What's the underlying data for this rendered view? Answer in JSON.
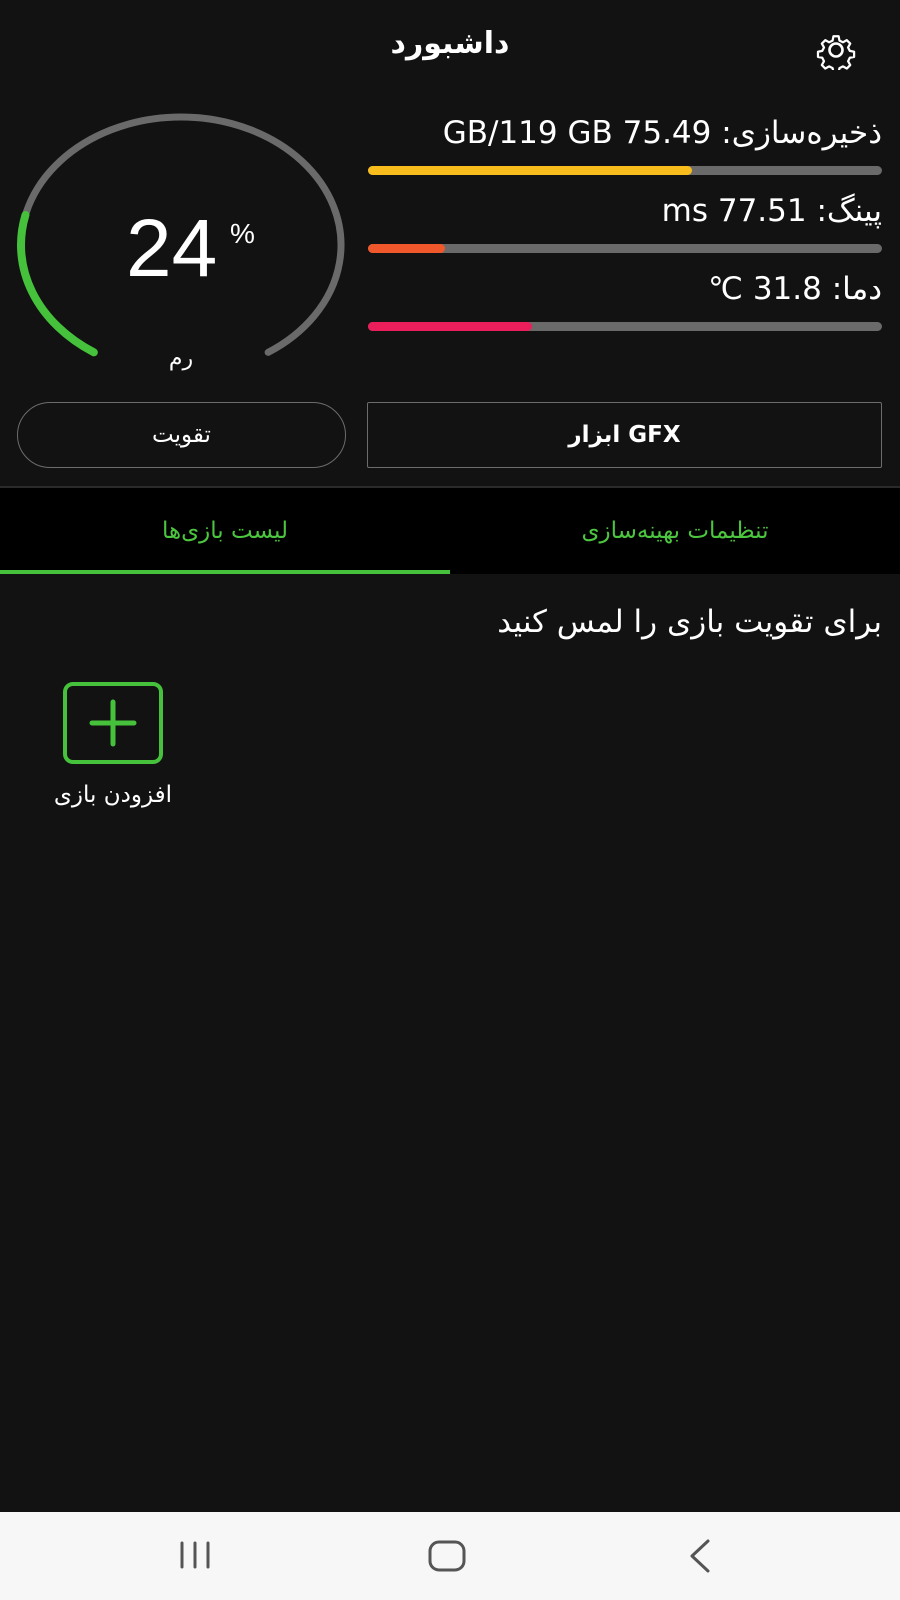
{
  "header": {
    "title": "داشبورد",
    "settings_icon": "gear-icon"
  },
  "gauge": {
    "value": "24",
    "unit": "%",
    "label": "رم",
    "percent": 24,
    "track_color": "#6a6a6a",
    "fill_color": "#45c13b"
  },
  "stats": [
    {
      "text": "ذخیره‌سازی: 75.49 GB/119 GB",
      "fill": 0.63,
      "color": "#f8bd1c"
    },
    {
      "text": "پینگ: 77.51 ms",
      "fill": 0.15,
      "color": "#f0582b"
    },
    {
      "text": "دما: 31.8 ℃",
      "fill": 0.32,
      "color": "#e91e5a"
    }
  ],
  "buttons": {
    "boost": "تقویت",
    "gfx": "ابزار GFX"
  },
  "tabs": [
    {
      "label": "لیست بازی‌ها",
      "active": true
    },
    {
      "label": "تنظیمات بهینه‌سازی",
      "active": false
    }
  ],
  "tab_color": "#4cc63f",
  "hint": "برای تقویت بازی را لمس کنید",
  "add_game": {
    "label": "افزودن بازی",
    "icon": "plus-icon"
  },
  "navbar": {
    "icons": [
      "recent-apps-icon",
      "home-icon",
      "back-icon"
    ]
  }
}
